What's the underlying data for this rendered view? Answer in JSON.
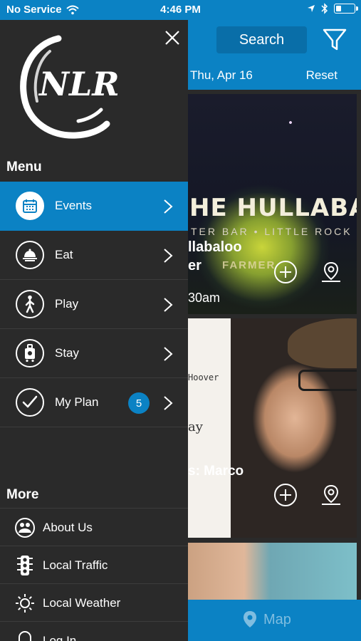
{
  "status_bar": {
    "carrier": "No Service",
    "time": "4:46 PM"
  },
  "header": {
    "search_label": "Search",
    "filter_icon": "filter-icon",
    "date_label": "Thu, Apr 16",
    "reset_label": "Reset"
  },
  "cards": [
    {
      "poster_text": "HE HULLABALOO",
      "poster_subtext": "TER BAR  •  LITTLE ROCK",
      "poster_overlay": "FARMER",
      "title_line1": "llabaloo",
      "title_line2": "er",
      "time": "30am"
    },
    {
      "poster_text": "Hoover",
      "poster_subtext": "ay",
      "title": "s: Marco"
    }
  ],
  "drawer": {
    "logo_text": "NLR",
    "menu_title": "Menu",
    "menu_items": [
      {
        "label": "Events",
        "icon": "calendar-icon",
        "active": true
      },
      {
        "label": "Eat",
        "icon": "food-cloche-icon",
        "active": false
      },
      {
        "label": "Play",
        "icon": "walking-person-icon",
        "active": false
      },
      {
        "label": "Stay",
        "icon": "luggage-icon",
        "active": false
      },
      {
        "label": "My Plan",
        "icon": "checkmark-icon",
        "active": false,
        "badge": "5"
      }
    ],
    "more_title": "More",
    "more_items": [
      {
        "label": "About Us",
        "icon": "people-icon"
      },
      {
        "label": "Local Traffic",
        "icon": "traffic-light-icon"
      },
      {
        "label": "Local Weather",
        "icon": "sun-icon"
      },
      {
        "label": "Log In",
        "icon": "login-icon"
      }
    ]
  },
  "bottom_bar": {
    "map_label": "Map"
  },
  "colors": {
    "accent": "#0b82c4",
    "drawer_bg": "#2a2a2a"
  }
}
